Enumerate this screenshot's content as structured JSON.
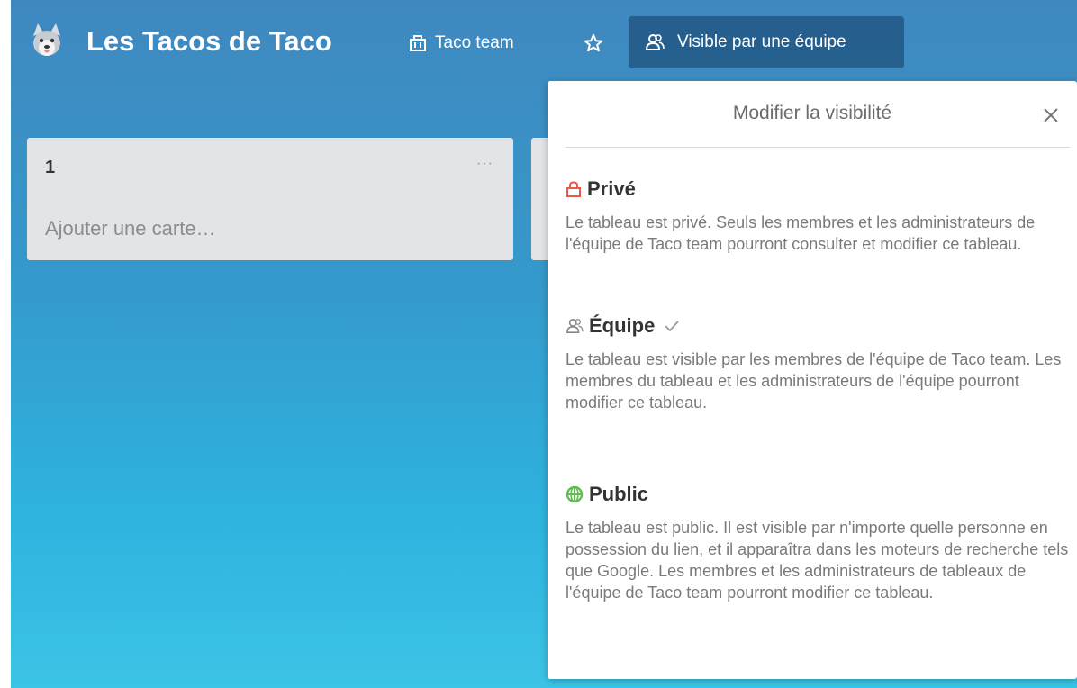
{
  "header": {
    "board_title": "Les Tacos de Taco",
    "team_name": "Taco team",
    "visibility_label": "Visible par une équipe"
  },
  "list": {
    "title": "1",
    "menu": "···",
    "add_card": "Ajouter une carte…"
  },
  "popover": {
    "title": "Modifier la visibilité",
    "options": [
      {
        "name": "Privé",
        "icon": "lock-icon",
        "icon_color": "#eb5a46",
        "description": "Le tableau est privé. Seuls les membres et les administrateurs de l'équipe de Taco team pourront consulter et modifier ce tableau.",
        "selected": false
      },
      {
        "name": "Équipe",
        "icon": "team-icon",
        "icon_color": "#888888",
        "description": "Le tableau est visible par les membres de l'équipe de Taco team. Les membres du tableau et les administrateurs de l'équipe pourront modifier ce tableau.",
        "selected": true
      },
      {
        "name": "Public",
        "icon": "globe-icon",
        "icon_color": "#61bd4f",
        "description": "Le tableau est public. Il est visible par n'importe quelle personne en possession du lien, et il apparaîtra dans les moteurs de recherche tels que Google. Les membres et les administrateurs de tableaux de l'équipe de Taco team pourront modifier ce tableau.",
        "selected": false
      }
    ]
  }
}
